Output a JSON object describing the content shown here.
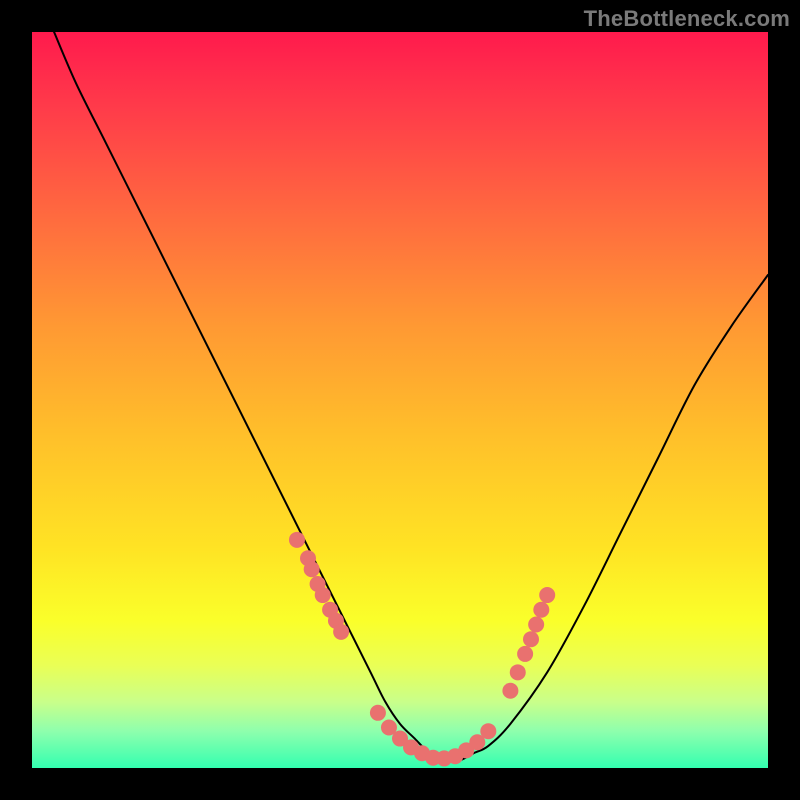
{
  "watermark": {
    "text": "TheBottleneck.com"
  },
  "colors": {
    "frame": "#000000",
    "gradient_top": "#ff1a4d",
    "gradient_bottom": "#33ffb0",
    "curve": "#000000",
    "marker": "#e9716f"
  },
  "chart_data": {
    "type": "line",
    "title": "",
    "xlabel": "",
    "ylabel": "",
    "xlim": [
      0,
      100
    ],
    "ylim": [
      0,
      100
    ],
    "grid": false,
    "legend": false,
    "series": [
      {
        "name": "curve",
        "x": [
          3,
          6,
          10,
          14,
          18,
          22,
          26,
          30,
          34,
          38,
          42,
          46,
          48,
          50,
          52,
          54,
          56,
          58,
          60,
          62,
          65,
          70,
          75,
          80,
          85,
          90,
          95,
          100
        ],
        "y": [
          100,
          93,
          85,
          77,
          69,
          61,
          53,
          45,
          37,
          29,
          21,
          13,
          9,
          6,
          4,
          2,
          1,
          1,
          2,
          3,
          6,
          13,
          22,
          32,
          42,
          52,
          60,
          67
        ]
      }
    ],
    "markers": [
      {
        "name": "left-cluster",
        "x": [
          36,
          37.5,
          38,
          38.8,
          39.5,
          40.5,
          41.3,
          42
        ],
        "y": [
          31,
          28.5,
          27,
          25,
          23.5,
          21.5,
          20,
          18.5
        ]
      },
      {
        "name": "valley-cluster",
        "x": [
          47,
          48.5,
          50,
          51.5,
          53,
          54.5,
          56,
          57.5,
          59,
          60.5,
          62
        ],
        "y": [
          7.5,
          5.5,
          4,
          2.8,
          2,
          1.4,
          1.3,
          1.6,
          2.4,
          3.5,
          5
        ]
      },
      {
        "name": "right-cluster",
        "x": [
          65,
          66,
          67,
          67.8,
          68.5,
          69.2,
          70
        ],
        "y": [
          10.5,
          13,
          15.5,
          17.5,
          19.5,
          21.5,
          23.5
        ]
      }
    ]
  }
}
